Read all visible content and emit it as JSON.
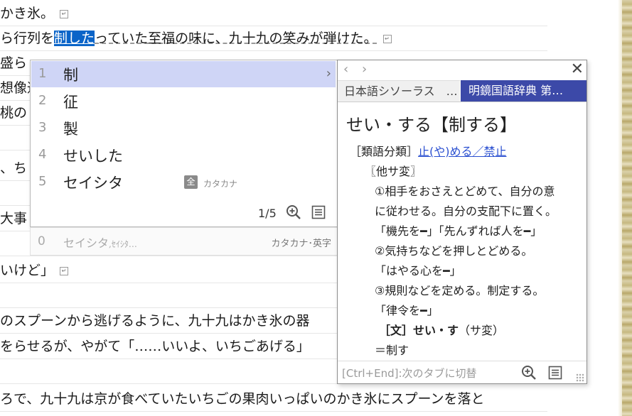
{
  "document": {
    "lines": [
      {
        "text": "かき氷。"
      },
      {
        "text_before": "ら行列を",
        "selected": "制した",
        "text_after": "っていた至福の味に、九十九の笑みが弾けた。"
      },
      {
        "text": "盛ら"
      },
      {
        "text": "想像通"
      },
      {
        "text": "桃の"
      },
      {
        "text": ""
      },
      {
        "text": "、ち"
      },
      {
        "text": ""
      },
      {
        "text": "大事"
      },
      {
        "text": ""
      },
      {
        "text": "いけど」"
      },
      {
        "text": ""
      },
      {
        "text": "のスプーンから逃げるように、九十九はかき氷の器"
      },
      {
        "text": "をらせるが、やがて「……いいよ、いちごあげる」"
      },
      {
        "text": ""
      },
      {
        "text": "ろで、九十九は京が食べていたいちごの果肉いっぱいのかき氷にスプーンを落と"
      }
    ]
  },
  "candidates": {
    "items": [
      {
        "num": "1",
        "text": "制",
        "selected": true
      },
      {
        "num": "2",
        "text": "征"
      },
      {
        "num": "3",
        "text": "製"
      },
      {
        "num": "4",
        "text": "せいした"
      },
      {
        "num": "5",
        "text": "セイシタ",
        "badge": "全",
        "badge_label": "カタカナ"
      }
    ],
    "page_indicator": "1/5",
    "expand_arrow": "›"
  },
  "prediction": {
    "num": "0",
    "text": "セイシタ",
    "small_text": ",ｾｲｼﾀ…",
    "category": "カタカナ･英字"
  },
  "dictionary": {
    "nav_back": "‹",
    "nav_forward": "›",
    "close": "✕",
    "tabs": [
      {
        "label": "日本語シソーラス　…"
      },
      {
        "label": "明鏡国語辞典 第…",
        "active": true
      }
    ],
    "headword": "せい・する【制する】",
    "category_label": "［類語分類］",
    "category_link": "止(や)める／禁止",
    "pos": "〖他サ変〗",
    "definition_lines": [
      "①相手をおさえとどめて、自分の意",
      "に従わせる。自分の支配下に置く。",
      "「機先を━」「先んずれば人を━」",
      "②気持ちなどを押しとどめる。",
      "「はやる心を━」",
      "③規則などを定める。制定する。",
      "「律令を━」"
    ],
    "bungo": "［文］せい・す",
    "bungo_note": "（サ変）",
    "equals": "＝制す",
    "footer_hint": "[Ctrl+End]:次のタブに切替"
  }
}
